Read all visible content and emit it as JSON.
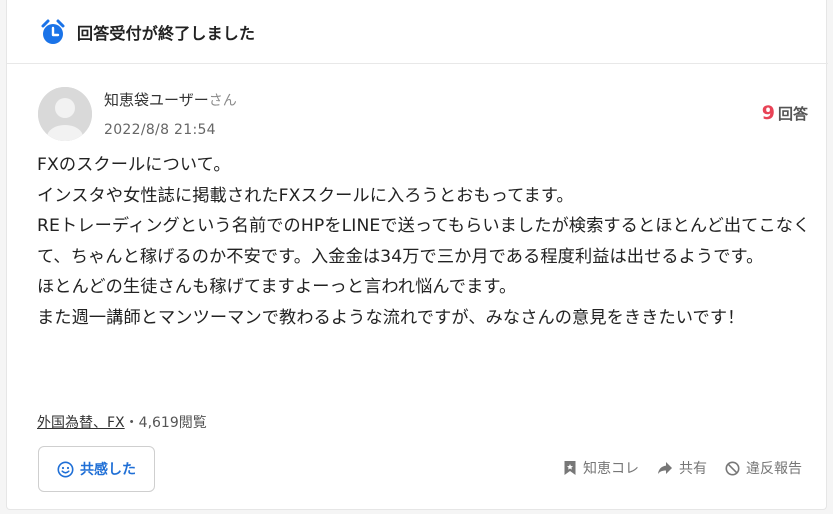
{
  "status": {
    "text": "回答受付が終了しました",
    "icon": "alarm-clock-icon",
    "icon_color": "#1a73e8"
  },
  "user": {
    "name": "知恵袋ユーザー",
    "suffix": "さん",
    "avatar": "default-avatar-icon"
  },
  "post": {
    "date": "2022/8/8 21:54"
  },
  "answers": {
    "count": "9",
    "label": "回答",
    "count_color": "#e84356"
  },
  "question": {
    "text": "FXのスクールについて。\nインスタや女性誌に掲載されたFXスクールに入ろうとおもってます。\nREトレーディングという名前でのHPをLINEで送ってもらいましたが検索するとほとんど出てこなくて、ちゃんと稼げるのか不安です。入金金は34万で三か月である程度利益は出せるようです。\nほとんどの生徒さんも稼げてますよーっと言われ悩んでます。\nまた週一講師とマンツーマンで教わるような流れですが、みなさんの意見をききたいです！"
  },
  "meta": {
    "category": "外国為替、FX",
    "separator": "・",
    "views": "4,619閲覧"
  },
  "actions": {
    "empathy": {
      "label": "共感した",
      "icon": "smile-icon",
      "color": "#1f6fd6"
    },
    "bookmark": {
      "label": "知恵コレ",
      "icon": "bookmark-icon"
    },
    "share": {
      "label": "共有",
      "icon": "share-arrow-icon"
    },
    "report": {
      "label": "違反報告",
      "icon": "prohibited-icon"
    }
  }
}
